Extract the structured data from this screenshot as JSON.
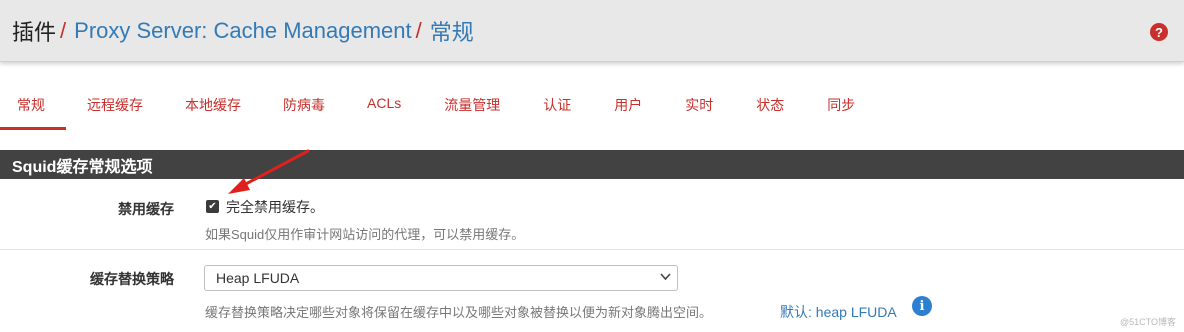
{
  "breadcrumb": {
    "root": "插件",
    "separator": "/",
    "middle": "Proxy Server: Cache Management",
    "current": "常规"
  },
  "help_icon": "?",
  "tabs": [
    {
      "label": "常规",
      "active": true
    },
    {
      "label": "远程缓存",
      "active": false
    },
    {
      "label": "本地缓存",
      "active": false
    },
    {
      "label": "防病毒",
      "active": false
    },
    {
      "label": "ACLs",
      "active": false
    },
    {
      "label": "流量管理",
      "active": false
    },
    {
      "label": "认证",
      "active": false
    },
    {
      "label": "用户",
      "active": false
    },
    {
      "label": "实时",
      "active": false
    },
    {
      "label": "状态",
      "active": false
    },
    {
      "label": "同步",
      "active": false
    }
  ],
  "section": {
    "title": "Squid缓存常规选项"
  },
  "disable_cache": {
    "label": "禁用缓存",
    "checked": true,
    "checkbox_label": "完全禁用缓存。",
    "help": "如果Squid仅用作审计网站访问的代理，可以禁用缓存。"
  },
  "replacement_policy": {
    "label": "缓存替换策略",
    "selected": "Heap LFUDA",
    "help": "缓存替换策略决定哪些对象将保留在缓存中以及哪些对象被替换以便为新对象腾出空间。",
    "default_text": "默认: heap LFUDA"
  },
  "watermark": "@51CTO博客",
  "colors": {
    "accent_red": "#c9302c",
    "link_blue": "#337ab7",
    "section_bg": "#424242",
    "header_bg": "#e8e8e8"
  }
}
